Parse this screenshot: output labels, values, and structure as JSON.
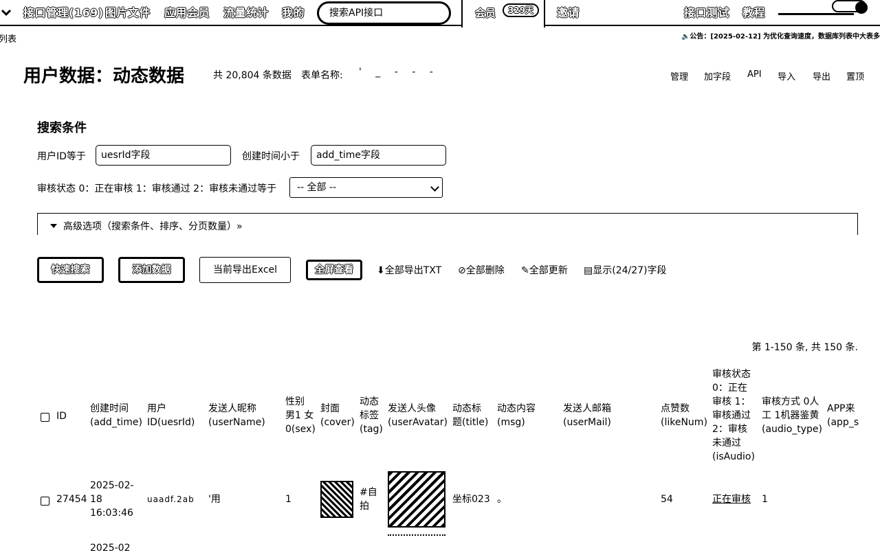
{
  "nav": {
    "items": [
      "接口管理(169)",
      "图片文件",
      "应用会员",
      "流量统计",
      "我的"
    ],
    "search_placeholder": "搜索API接口",
    "vip_label": "会员",
    "vip_days": "329天",
    "invite": "邀请",
    "api_test": "接口测试",
    "tutorial": "教程"
  },
  "breadcrumb": "列表",
  "notice": "公告：[2025-02-12] 为优化查询速度，数据库列表中大表多",
  "header": {
    "title": "用户数据：动态数据",
    "count": "共 20,804 条数据",
    "form_name_label": "表单名称:",
    "form_name_value": "' _ - - -"
  },
  "actions": [
    "管理",
    "加字段",
    "API",
    "导入",
    "导出",
    "置顶"
  ],
  "search": {
    "title": "搜索条件",
    "user_id_label": "用户ID等于",
    "user_id_value": "uesrId字段",
    "add_time_label": "创建时间小于",
    "add_time_value": "add_time字段",
    "audit_label": "审核状态 0：正在审核 1：审核通过 2：审核未通过等于",
    "audit_selected": "-- 全部 --",
    "advanced": "高级选项（搜索条件、排序、分页数量）»"
  },
  "buttons": {
    "quick_search": "快速搜索",
    "add_data": "添加数据",
    "export_excel": "当前导出Excel",
    "fullscreen": "全屏查看",
    "export_txt": "全部导出TXT",
    "delete_all": "全部删除",
    "update_all": "全部更新",
    "show_fields": "显示(24/27)字段"
  },
  "pager": "第 1-150 条, 共 150 条.",
  "table": {
    "columns": [
      [
        "ID"
      ],
      [
        "创建时间",
        "(add_time)"
      ],
      [
        "用户",
        "ID(uesrId)"
      ],
      [
        "发送人昵称",
        "(userName)"
      ],
      [
        "性别",
        "男1 女",
        "0(sex)"
      ],
      [
        "封面",
        "(cover)"
      ],
      [
        "动态",
        "标签",
        "(tag)"
      ],
      [
        "发送人头像",
        "(userAvatar)"
      ],
      [
        "动态标",
        "题(title)"
      ],
      [
        "动态内容",
        "(msg)"
      ],
      [
        "发送人邮箱",
        "(userMail)"
      ],
      [
        "点赞数",
        "(likeNum)"
      ],
      [
        "审核状态",
        "0：正在",
        "审核 1：",
        "审核通过",
        "2：审核",
        "未通过",
        "(isAudio)"
      ],
      [
        "审核方式 0人",
        "工 1机器鉴黄",
        "(audio_type)"
      ],
      [
        "APP来",
        "(app_s"
      ]
    ],
    "rows": [
      {
        "id": "27454",
        "add_time": [
          "2025-02-",
          "18",
          "16:03:46"
        ],
        "user_id": "uaadf.2ab",
        "user_name": "'用",
        "sex": "1",
        "tag": [
          "#自",
          "拍"
        ],
        "title": "坐标023",
        "msg": "。",
        "like": "54",
        "audit": "正在审核",
        "audit_type": "1"
      },
      {
        "add_time": [
          "2025-02"
        ]
      }
    ]
  }
}
